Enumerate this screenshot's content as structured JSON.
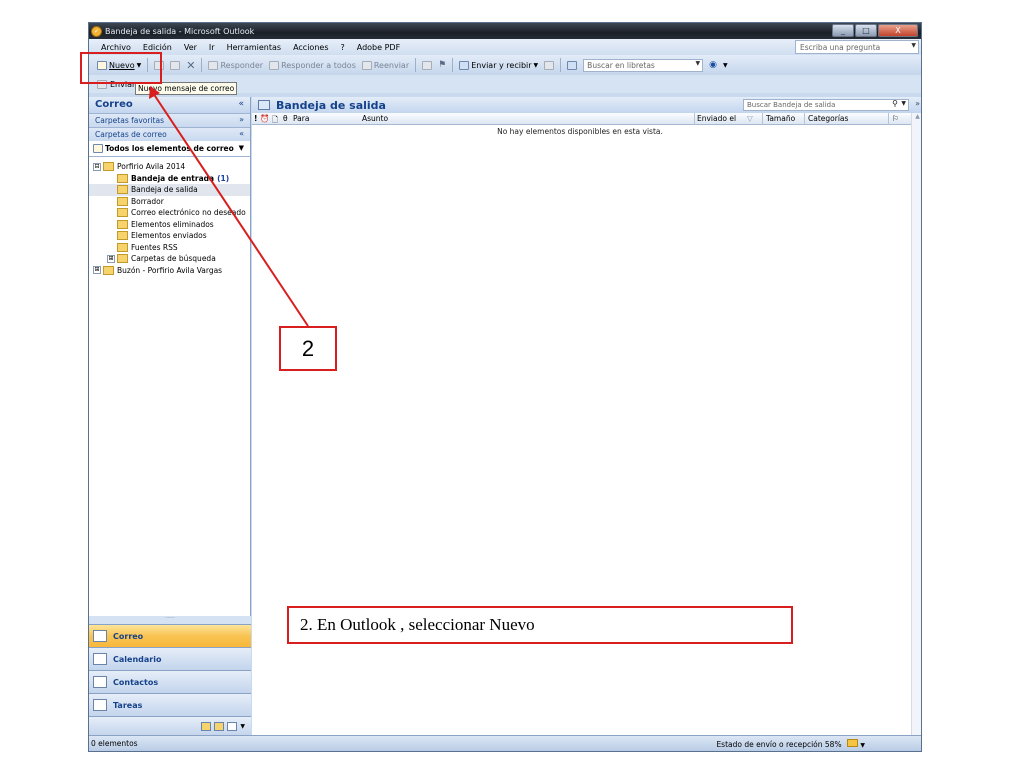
{
  "window": {
    "title": "Bandeja de salida - Microsoft Outlook",
    "controls": [
      "_",
      "□",
      "X"
    ]
  },
  "menu": {
    "items": [
      "Archivo",
      "Edición",
      "Ver",
      "Ir",
      "Herramientas",
      "Acciones",
      "?",
      "Adobe PDF"
    ],
    "ask_placeholder": "Escriba una pregunta"
  },
  "toolbar": {
    "new_label": "Nuevo",
    "reply_label": "Responder",
    "reply_all_label": "Responder a todos",
    "forward_label": "Reenviar",
    "send_receive_label": "Enviar y recibir",
    "search_books_placeholder": "Buscar en libretas",
    "second_row_label": "Enviar",
    "tooltip": "Nuevo mensaje de correo"
  },
  "nav": {
    "header": "Correo",
    "favorites": "Carpetas favoritas",
    "mail_folders": "Carpetas de correo",
    "all_items": "Todos los elementos de correo",
    "tree": [
      {
        "label": "Porfirio Avila 2014",
        "level": 0,
        "expander": "⊟"
      },
      {
        "label": "Bandeja de entrada",
        "level": 1,
        "bold": true,
        "count": "(1)"
      },
      {
        "label": "Bandeja de salida",
        "level": 1,
        "selected": true
      },
      {
        "label": "Borrador",
        "level": 1
      },
      {
        "label": "Correo electrónico no deseado",
        "level": 1
      },
      {
        "label": "Elementos eliminados",
        "level": 1
      },
      {
        "label": "Elementos enviados",
        "level": 1
      },
      {
        "label": "Fuentes RSS",
        "level": 1
      },
      {
        "label": "Carpetas de búsqueda",
        "level": 1,
        "expander": "⊞"
      },
      {
        "label": "Buzón - Porfirio Avila Vargas",
        "level": 0,
        "expander": "⊞"
      }
    ],
    "buttons": [
      "Correo",
      "Calendario",
      "Contactos",
      "Tareas"
    ]
  },
  "content": {
    "title": "Bandeja de salida",
    "search_placeholder": "Buscar Bandeja de salida",
    "columns": {
      "para": "Para",
      "asunto": "Asunto",
      "enviado": "Enviado el",
      "tamano": "Tamaño",
      "categorias": "Categorías"
    },
    "empty_text": "No hay elementos disponibles en esta vista."
  },
  "status": {
    "left": "0 elementos",
    "right": "Estado de envío o recepción 58%"
  },
  "annotation": {
    "step_number": "2",
    "caption": "2. En Outlook , seleccionar Nuevo",
    "color": "#d81e1e"
  }
}
